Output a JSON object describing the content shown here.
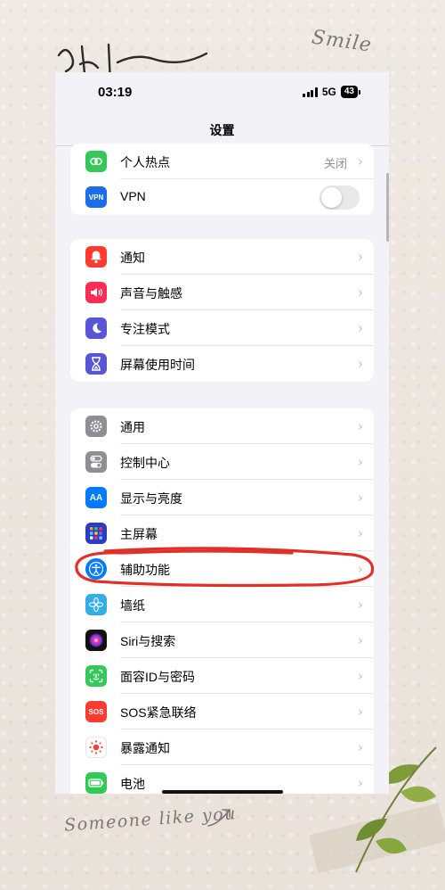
{
  "status_bar": {
    "time": "03:19",
    "network": "5G",
    "battery": "43"
  },
  "nav": {
    "title": "设置"
  },
  "icons": {
    "vpn_label": "VPN",
    "aa_label": "AA",
    "sos_label": "SOS"
  },
  "groups": [
    {
      "rows": [
        {
          "label": "个人热点",
          "value": "关闭",
          "icon": "hotspot-icon",
          "color": "#34c759"
        },
        {
          "label": "VPN",
          "value": "",
          "icon": "vpn-icon",
          "color": "#1a6fe8",
          "toggle": "off"
        }
      ]
    },
    {
      "rows": [
        {
          "label": "通知",
          "icon": "bell-icon",
          "color": "#ff3b30"
        },
        {
          "label": "声音与触感",
          "icon": "speaker-icon",
          "color": "#ff2d55"
        },
        {
          "label": "专注模式",
          "icon": "moon-icon",
          "color": "#5856d6"
        },
        {
          "label": "屏幕使用时间",
          "icon": "hourglass-icon",
          "color": "#5856d6"
        }
      ]
    },
    {
      "rows": [
        {
          "label": "通用",
          "icon": "gear-icon",
          "color": "#8e8e93"
        },
        {
          "label": "控制中心",
          "icon": "toggles-icon",
          "color": "#8e8e93"
        },
        {
          "label": "显示与亮度",
          "icon": "text-size-icon",
          "color": "#007aff"
        },
        {
          "label": "主屏幕",
          "icon": "home-grid-icon",
          "color": "#2c3cc7"
        },
        {
          "label": "辅助功能",
          "icon": "accessibility-icon",
          "color": "#007aff"
        },
        {
          "label": "墙纸",
          "icon": "flower-icon",
          "color": "#32ade6"
        },
        {
          "label": "Siri与搜索",
          "icon": "siri-icon",
          "color": "#111111"
        },
        {
          "label": "面容ID与密码",
          "icon": "face-id-icon",
          "color": "#34c759"
        },
        {
          "label": "SOS紧急联络",
          "icon": "sos-icon",
          "color": "#ff3b30"
        },
        {
          "label": "暴露通知",
          "icon": "exposure-icon",
          "color": "#ffffff"
        },
        {
          "label": "电池",
          "icon": "battery-icon",
          "color": "#34c759"
        }
      ]
    }
  ],
  "decor": {
    "smile_text": "Smile",
    "someone_text": "Someone like you"
  }
}
